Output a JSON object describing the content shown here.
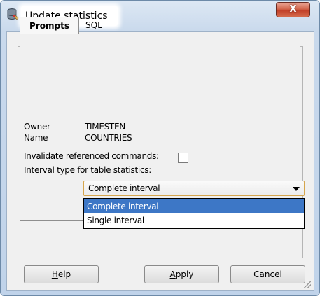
{
  "window": {
    "title": "Update statistics",
    "close_glyph": "X",
    "title_icon": "database-icon"
  },
  "tabs": [
    {
      "label": "Prompts",
      "active": true
    },
    {
      "label": "SQL",
      "active": false
    }
  ],
  "form": {
    "owner_label": "Owner",
    "owner_value": "TIMESTEN",
    "name_label": "Name",
    "name_value": "COUNTRIES",
    "invalidate_label": "Invalidate referenced commands:",
    "invalidate_checked": false,
    "interval_label": "Interval type for table statistics:",
    "interval_selected": "Complete interval",
    "interval_options": [
      "Complete interval",
      "Single interval"
    ]
  },
  "buttons": {
    "help": {
      "mnemonic": "H",
      "rest": "elp"
    },
    "apply": {
      "mnemonic": "A",
      "rest": "pply"
    },
    "cancel": "Cancel"
  },
  "colors": {
    "selection": "#3d77c6",
    "combo_focus_border": "#d5a54c",
    "close_button": "#c24028"
  }
}
